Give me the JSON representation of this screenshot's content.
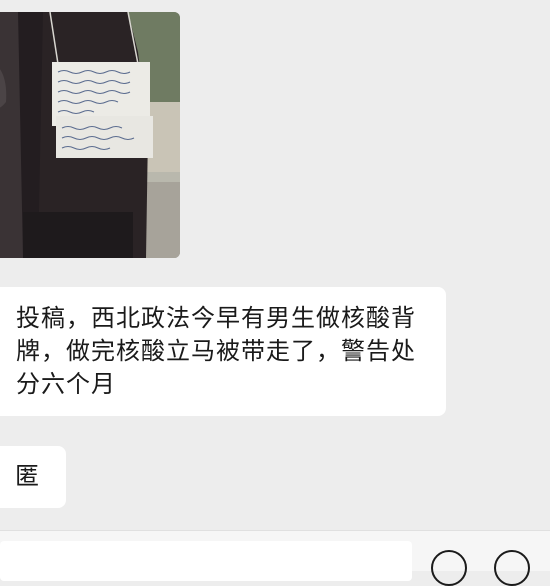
{
  "chat": {
    "messages": [
      {
        "type": "image",
        "icon": "photo-of-person-with-sign"
      },
      {
        "type": "text",
        "text": "投稿，西北政法今早有男生做核酸背牌，做完核酸立马被带走了，警告处分六个月"
      },
      {
        "type": "text",
        "text": "匿"
      }
    ]
  },
  "input_bar": {
    "input_value": "",
    "emoji_icon": "emoji-icon",
    "plus_icon": "plus-icon"
  },
  "colors": {
    "background": "#ededed",
    "bubble": "#ffffff",
    "text": "#1a1a1a"
  }
}
